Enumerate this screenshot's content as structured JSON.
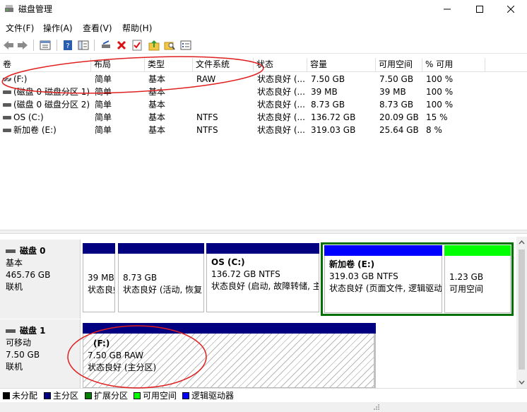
{
  "window": {
    "title": "磁盘管理",
    "app_icon": "disk-management-icon"
  },
  "window_controls": {
    "minimize_icon": "minimize-icon",
    "maximize_icon": "maximize-icon",
    "close_icon": "close-icon"
  },
  "menu": {
    "file": "文件(F)",
    "action": "操作(A)",
    "view": "查看(V)",
    "help": "帮助(H)"
  },
  "toolbar": {
    "icons": [
      "back-icon",
      "forward-icon",
      "properties-list-icon",
      "help-icon",
      "show-hide-console-tree-icon",
      "connect-disk-icon",
      "delete-icon",
      "check-properties-icon",
      "refresh-folder-icon",
      "search-folder-icon",
      "settings-list-icon"
    ]
  },
  "volume_list": {
    "headers": {
      "volume": "卷",
      "layout": "布局",
      "type": "类型",
      "filesystem": "文件系统",
      "status": "状态",
      "capacity": "容量",
      "free": "可用空间",
      "percent_free": "% 可用"
    },
    "rows": [
      {
        "volume": "(F:)",
        "layout": "简单",
        "type": "基本",
        "filesystem": "RAW",
        "status": "状态良好 (...",
        "capacity": "7.50 GB",
        "free": "7.50 GB",
        "percent": "100 %"
      },
      {
        "volume": "(磁盘 0 磁盘分区 1)",
        "layout": "简单",
        "type": "基本",
        "filesystem": "",
        "status": "状态良好 (...",
        "capacity": "39 MB",
        "free": "39 MB",
        "percent": "100 %"
      },
      {
        "volume": "(磁盘 0 磁盘分区 2)",
        "layout": "简单",
        "type": "基本",
        "filesystem": "",
        "status": "状态良好 (...",
        "capacity": "8.73 GB",
        "free": "8.73 GB",
        "percent": "100 %"
      },
      {
        "volume": "OS (C:)",
        "layout": "简单",
        "type": "基本",
        "filesystem": "NTFS",
        "status": "状态良好 (...",
        "capacity": "136.72 GB",
        "free": "20.09 GB",
        "percent": "15 %"
      },
      {
        "volume": "新加卷 (E:)",
        "layout": "简单",
        "type": "基本",
        "filesystem": "NTFS",
        "status": "状态良好 (...",
        "capacity": "319.03 GB",
        "free": "25.64 GB",
        "percent": "8 %"
      }
    ]
  },
  "disks": [
    {
      "name": "磁盘 0",
      "kind": "基本",
      "size": "465.76 GB",
      "state": "联机",
      "partitions": [
        {
          "name": "",
          "line1": "39 MB",
          "line2": "状态良好",
          "bar_color": "#000080"
        },
        {
          "name": "",
          "line1": "8.73 GB",
          "line2": "状态良好 (活动, 恢复",
          "bar_color": "#000080"
        },
        {
          "name": "OS  (C:)",
          "line1": "136.72 GB NTFS",
          "line2": "状态良好 (启动, 故障转储, 主",
          "bar_color": "#000080"
        },
        {
          "name": "新加卷  (E:)",
          "line1": "319.03 GB NTFS",
          "line2": "状态良好 (页面文件, 逻辑驱动",
          "bar_color": "#0000ff"
        },
        {
          "name": "",
          "line1": "1.23 GB",
          "line2": "可用空间",
          "bar_color": "#00ff00"
        }
      ]
    },
    {
      "name": "磁盘 1",
      "kind": "可移动",
      "size": "7.50 GB",
      "state": "联机",
      "partitions": [
        {
          "name": "(F:)",
          "line1": "7.50 GB RAW",
          "line2": "状态良好 (主分区)",
          "bar_color": "#000080"
        }
      ]
    }
  ],
  "legend": [
    {
      "label": "未分配",
      "color": "#000000"
    },
    {
      "label": "主分区",
      "color": "#000080"
    },
    {
      "label": "扩展分区",
      "color": "#008000"
    },
    {
      "label": "可用空间",
      "color": "#00ff00"
    },
    {
      "label": "逻辑驱动器",
      "color": "#0000ff"
    }
  ],
  "annotations": {
    "color": "#e02020"
  }
}
